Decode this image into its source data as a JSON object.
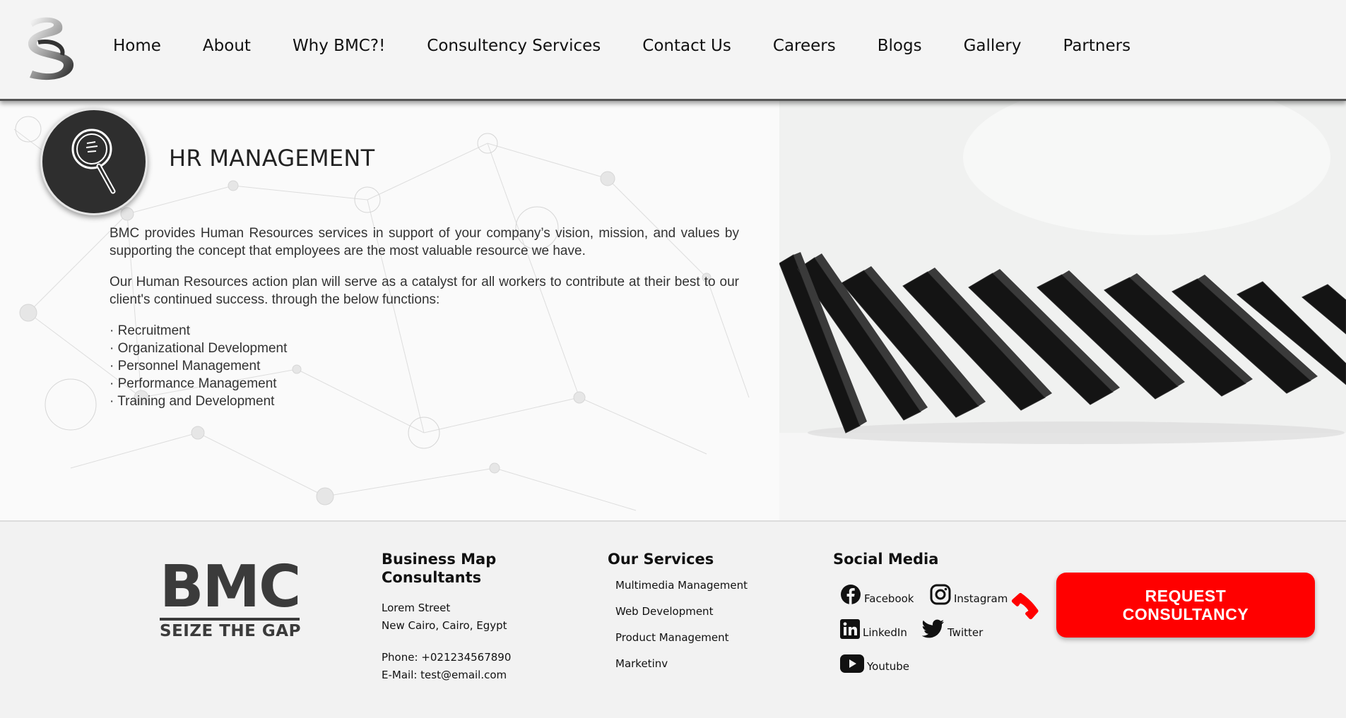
{
  "nav": {
    "items": [
      "Home",
      "About",
      "Why BMC?!",
      "Consultency Services",
      "Contact Us",
      "Careers",
      "Blogs",
      "Gallery",
      "Partners"
    ]
  },
  "hero": {
    "title": "HR MANAGEMENT",
    "icon": "magnifier-icon",
    "paragraph1": "BMC provides Human Resources services in support of your company’s vision, mission, and values by supporting the concept that employees are the most valuable resource we have.",
    "paragraph2": "Our Human Resources action plan will serve as a catalyst for all workers to contribute at their best to our client's continued success. through the below functions:",
    "functions": [
      "· Recruitment",
      "· Organizational Development",
      "· Personnel Management",
      "· Performance Management",
      "· Training and Development"
    ]
  },
  "footer": {
    "logo_text": "BMC",
    "logo_tagline": "SEIZE THE GAP",
    "company": {
      "name": "Business Map Consultants",
      "street": "Lorem Street",
      "city": "New Cairo, Cairo, Egypt",
      "phone": "Phone: +021234567890",
      "email": "E-Mail: test@email.com"
    },
    "services": {
      "heading": "Our Services",
      "items": [
        "Multimedia Management",
        "Web Development",
        "Product Management",
        "Marketinv"
      ]
    },
    "social": {
      "heading": "Social Media",
      "facebook": "Facebook",
      "instagram": "Instagram",
      "linkedin": "LinkedIn",
      "twitter": "Twitter",
      "youtube": "Youtube"
    },
    "cta_label": "REQUEST\nCONSULTANCY"
  },
  "colors": {
    "accent": "#ff0000",
    "dark": "#2e2e2e",
    "text": "#333333"
  }
}
